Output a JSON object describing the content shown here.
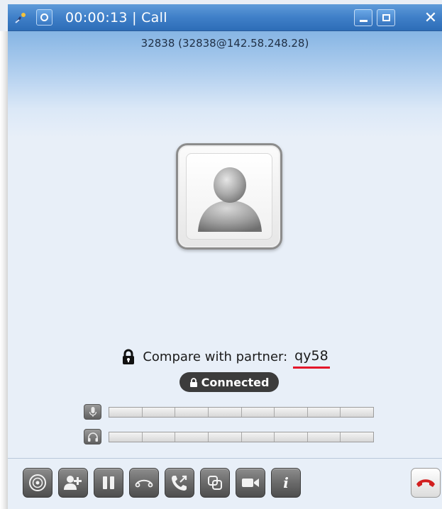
{
  "window": {
    "title": "00:00:13 | Call"
  },
  "titlebar": {
    "app_icon": "phone-app-icon",
    "menu_icon": "circle-menu-icon",
    "minimize_icon": "minimize-icon",
    "maximize_icon": "maximize-icon",
    "close_icon": "close-icon",
    "close_glyph": "✕"
  },
  "call": {
    "peer": "32838 (32838@142.58.248.28)",
    "avatar_icon": "user-avatar-icon"
  },
  "security": {
    "compare_label": "Compare with partner:",
    "sas_code": "qy58",
    "status": "Connected",
    "lock_icon": "padlock-icon",
    "underline_color": "#e4162a"
  },
  "meters": {
    "microphone": {
      "icon": "microphone-icon",
      "level": 0,
      "segments": 8
    },
    "speaker": {
      "icon": "headphones-icon",
      "level": 0,
      "segments": 8
    }
  },
  "toolbar": {
    "buttons": [
      {
        "name": "dialpad-button",
        "icon": "dialpad-icon"
      },
      {
        "name": "add-participant-button",
        "icon": "add-user-icon"
      },
      {
        "name": "hold-button",
        "icon": "pause-icon"
      },
      {
        "name": "transfer-button",
        "icon": "handset-icon"
      },
      {
        "name": "call-transfer-button",
        "icon": "phone-forward-icon"
      },
      {
        "name": "merge-calls-button",
        "icon": "merge-icon"
      },
      {
        "name": "video-button",
        "icon": "video-camera-icon"
      },
      {
        "name": "info-button",
        "icon": "info-icon",
        "glyph": "i"
      }
    ],
    "hangup": {
      "name": "hangup-button",
      "icon": "hangup-icon",
      "color": "#d21f1f"
    }
  },
  "colors": {
    "titlebar": "#3f7fc8",
    "content_background": "#e8eff8",
    "badge_background": "#3c3c3c"
  }
}
